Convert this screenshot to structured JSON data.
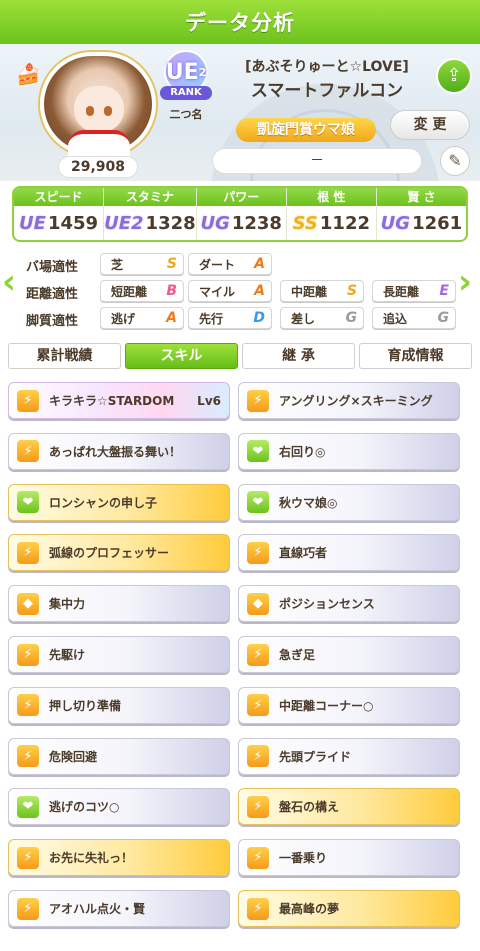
{
  "header": {
    "title": "データ分析"
  },
  "profile": {
    "fans": "29,908",
    "rank_label": "RANK",
    "rank_grade": "UE",
    "rank_sub": "2",
    "nickname": "二つ名",
    "title_line1": "[あぶそりゅーと☆LOVE]",
    "title_line2": "スマートファルコン",
    "epithet": "凱旋門賞ウマ娘",
    "change_button": "変 更",
    "comment": "－"
  },
  "stats": [
    {
      "label": "スピード",
      "grade": "UE",
      "value": "1459",
      "icon": "shoe-icon"
    },
    {
      "label": "スタミナ",
      "grade": "UE2",
      "value": "1328",
      "icon": "heart-icon"
    },
    {
      "label": "パワー",
      "grade": "UG",
      "value": "1238",
      "icon": "muscle-icon"
    },
    {
      "label": "根 性",
      "grade": "SS",
      "value": "1122",
      "icon": "flame-icon"
    },
    {
      "label": "賢 さ",
      "grade": "UG",
      "value": "1261",
      "icon": "graduation-cap-icon"
    }
  ],
  "aptitude": {
    "track_label": "バ場適性",
    "distance_label": "距離適性",
    "style_label": "脚質適性",
    "track": [
      {
        "name": "芝",
        "grade": "S"
      },
      {
        "name": "ダート",
        "grade": "A"
      }
    ],
    "distance": [
      {
        "name": "短距離",
        "grade": "B"
      },
      {
        "name": "マイル",
        "grade": "A"
      },
      {
        "name": "中距離",
        "grade": "S"
      },
      {
        "name": "長距離",
        "grade": "E"
      }
    ],
    "style": [
      {
        "name": "逃げ",
        "grade": "A"
      },
      {
        "name": "先行",
        "grade": "D"
      },
      {
        "name": "差し",
        "grade": "G"
      },
      {
        "name": "追込",
        "grade": "G"
      }
    ]
  },
  "grade_colors": {
    "S": "#f0a81a",
    "A": "#f07a1a",
    "B": "#ef5a8a",
    "D": "#3a9ae8",
    "E": "#a46ad8",
    "G": "#9a9a9a"
  },
  "tabs": [
    "累計戦績",
    "スキル",
    "継 承",
    "育成情報"
  ],
  "active_tab": 1,
  "skills": [
    {
      "name": "キラキラ☆STARDOM",
      "level": "Lv6",
      "type": "uniq",
      "icon": "spd"
    },
    {
      "name": "アングリング×スキーミング",
      "level": "",
      "type": "norm",
      "icon": "spd"
    },
    {
      "name": "あっぱれ大盤振る舞い！",
      "level": "",
      "type": "norm",
      "icon": "spd"
    },
    {
      "name": "右回り◎",
      "level": "",
      "type": "norm",
      "icon": "sta"
    },
    {
      "name": "ロンシャンの申し子",
      "level": "",
      "type": "gold",
      "icon": "sta"
    },
    {
      "name": "秋ウマ娘◎",
      "level": "",
      "type": "norm",
      "icon": "sta"
    },
    {
      "name": "弧線のプロフェッサー",
      "level": "",
      "type": "gold",
      "icon": "spd"
    },
    {
      "name": "直線巧者",
      "level": "",
      "type": "norm",
      "icon": "spd"
    },
    {
      "name": "集中力",
      "level": "",
      "type": "norm",
      "icon": "ctl"
    },
    {
      "name": "ポジションセンス",
      "level": "",
      "type": "norm",
      "icon": "ctl"
    },
    {
      "name": "先駆け",
      "level": "",
      "type": "norm",
      "icon": "spd"
    },
    {
      "name": "急ぎ足",
      "level": "",
      "type": "norm",
      "icon": "spd"
    },
    {
      "name": "押し切り準備",
      "level": "",
      "type": "norm",
      "icon": "spd"
    },
    {
      "name": "中距離コーナー○",
      "level": "",
      "type": "norm",
      "icon": "spd"
    },
    {
      "name": "危険回避",
      "level": "",
      "type": "norm",
      "icon": "spd"
    },
    {
      "name": "先頭プライド",
      "level": "",
      "type": "norm",
      "icon": "spd"
    },
    {
      "name": "逃げのコツ○",
      "level": "",
      "type": "norm",
      "icon": "sta"
    },
    {
      "name": "盤石の構え",
      "level": "",
      "type": "gold",
      "icon": "spd"
    },
    {
      "name": "お先に失礼っ！",
      "level": "",
      "type": "gold",
      "icon": "spd"
    },
    {
      "name": "一番乗り",
      "level": "",
      "type": "norm",
      "icon": "spd"
    },
    {
      "name": "アオハル点火・賢",
      "level": "",
      "type": "norm",
      "icon": "spd"
    },
    {
      "name": "最高峰の夢",
      "level": "",
      "type": "gold",
      "icon": "spd"
    }
  ]
}
